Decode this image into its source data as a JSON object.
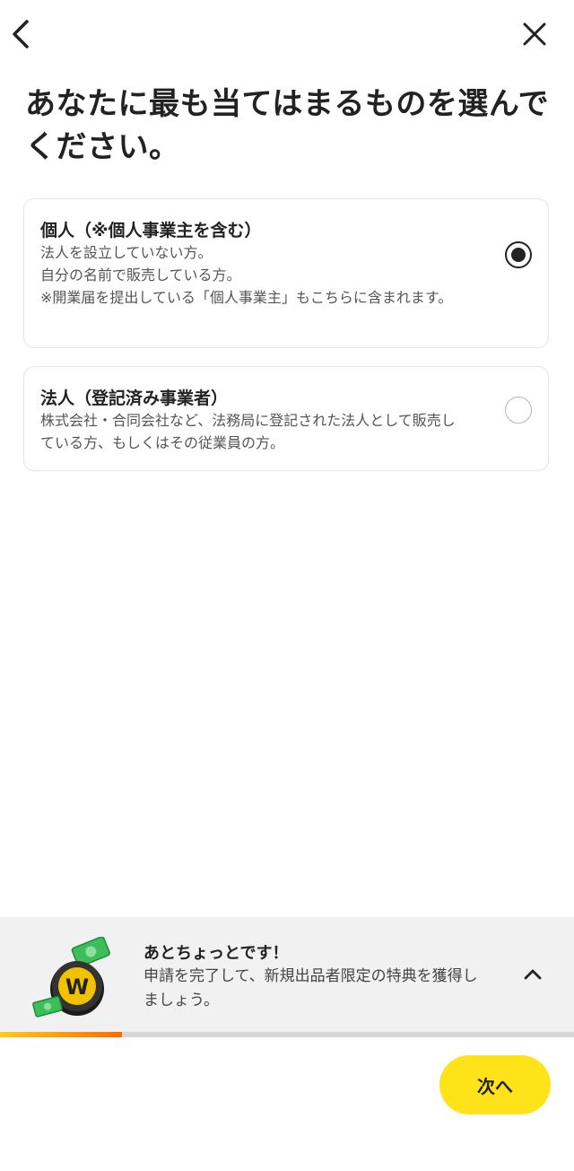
{
  "header": {
    "back_icon": "chevron-left-icon",
    "close_icon": "close-icon"
  },
  "page": {
    "title": "あなたに最も当てはまるものを選んでください。"
  },
  "options": [
    {
      "title": "個人（※個人事業主を含む）",
      "desc": "法人を設立していない方。\n自分の名前で販売している方。\n※開業届を提出している「個人事業主」もこちらに含まれます。",
      "selected": true
    },
    {
      "title": "法人（登記済み事業者）",
      "desc": "株式会社・合同会社など、法務局に登記された法人として販売している方、もしくはその従業員の方。",
      "selected": false
    }
  ],
  "promo": {
    "heading": "あとちょっとです！",
    "body": "申請を完了して、新規出品者限定の特典を獲得しましょう。",
    "toggle_icon": "chevron-up-icon",
    "illustration_icon": "coin-cash-icon"
  },
  "progress": {
    "value": 0.213
  },
  "footer": {
    "next_label": "次へ"
  },
  "colors": {
    "accent": "#ffe31a",
    "progress_start": "#ffcc1a",
    "progress_end": "#ff6a00"
  }
}
